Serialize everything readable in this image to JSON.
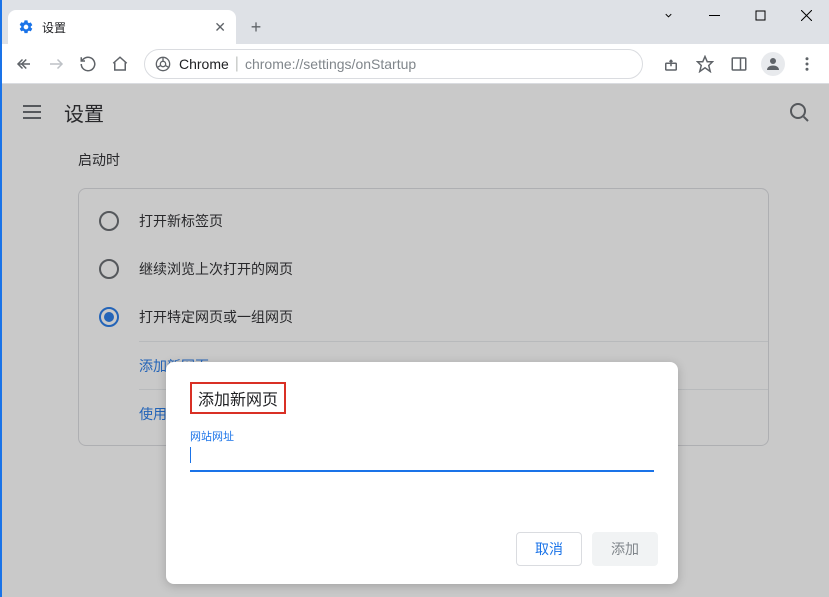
{
  "titlebar": {
    "tab_title": "设置"
  },
  "toolbar": {
    "omnibox_origin": "Chrome",
    "omnibox_path": "chrome://settings/onStartup"
  },
  "settings": {
    "header_title": "设置",
    "section_title": "启动时",
    "options": [
      "打开新标签页",
      "继续浏览上次打开的网页",
      "打开特定网页或一组网页"
    ],
    "sub_links": [
      "添加新网页",
      "使用当前网页"
    ]
  },
  "dialog": {
    "title": "添加新网页",
    "field_label": "网站网址",
    "input_value": "",
    "cancel_label": "取消",
    "add_label": "添加"
  }
}
